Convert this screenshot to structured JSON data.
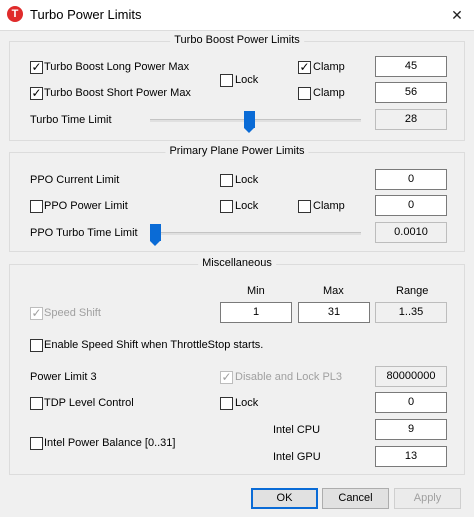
{
  "window": {
    "title": "Turbo Power Limits",
    "app_icon_glyph": "T",
    "close_glyph": "✕"
  },
  "turbo_boost": {
    "title": "Turbo Boost Power Limits",
    "long_label": "Turbo Boost Long Power Max",
    "long_checked": true,
    "short_label": "Turbo Boost Short Power Max",
    "short_checked": true,
    "lock_label": "Lock",
    "lock_checked": false,
    "clamp1_label": "Clamp",
    "clamp1_checked": true,
    "clamp2_label": "Clamp",
    "clamp2_checked": false,
    "long_value": "45",
    "short_value": "56",
    "time_limit_label": "Turbo Time Limit",
    "time_limit_value": "28"
  },
  "ppo": {
    "title": "Primary Plane Power Limits",
    "current_limit_label": "PPO Current Limit",
    "current_lock_label": "Lock",
    "current_value": "0",
    "power_limit_label": "PPO Power Limit",
    "power_limit_checked": false,
    "power_lock_label": "Lock",
    "clamp_label": "Clamp",
    "power_value": "0",
    "turbo_time_label": "PPO Turbo Time Limit",
    "turbo_time_value": "0.0010"
  },
  "misc": {
    "title": "Miscellaneous",
    "col_min": "Min",
    "col_max": "Max",
    "col_range": "Range",
    "speed_shift_label": "Speed Shift",
    "speed_shift_min": "1",
    "speed_shift_max": "31",
    "speed_shift_range": "1..35",
    "enable_speed_shift_label": "Enable Speed Shift when ThrottleStop starts.",
    "power_limit3_label": "Power Limit 3",
    "disable_lock_pl3_label": "Disable and Lock PL3",
    "power_limit3_value": "80000000",
    "tdp_label": "TDP Level Control",
    "tdp_lock_label": "Lock",
    "tdp_value": "0",
    "intel_power_balance_label": "Intel Power Balance  [0..31]",
    "intel_cpu_label": "Intel CPU",
    "intel_cpu_value": "9",
    "intel_gpu_label": "Intel GPU",
    "intel_gpu_value": "13"
  },
  "buttons": {
    "ok": "OK",
    "cancel": "Cancel",
    "apply": "Apply"
  },
  "colors": {
    "accent": "#0a6bd6",
    "icon_red": "#e02b2b",
    "window_bg": "#f0f0f0"
  },
  "sliders": {
    "turbo_time_fraction": 0.47,
    "ppo_turbo_time_fraction": 0.0
  }
}
